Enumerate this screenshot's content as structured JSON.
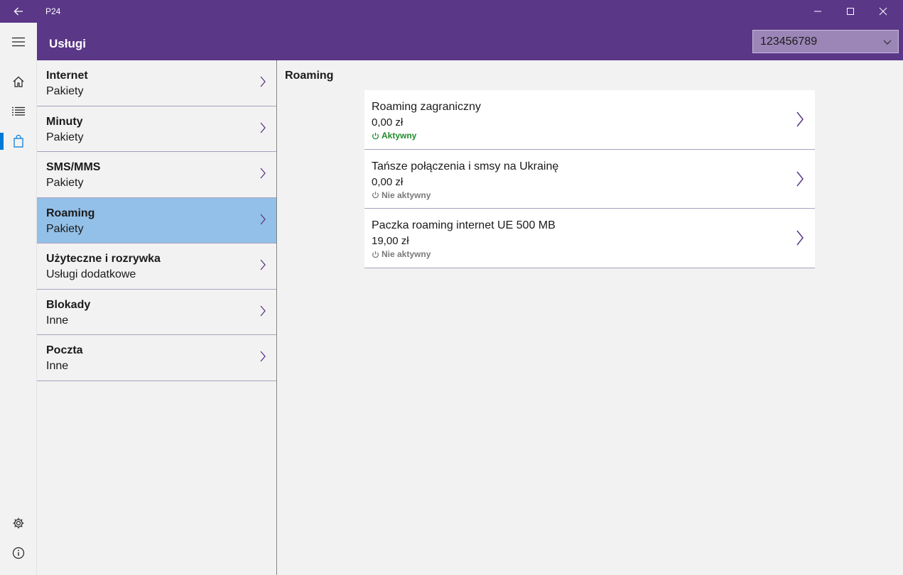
{
  "window": {
    "app_title": "P24",
    "icons": {
      "back": "back-arrow-icon",
      "minimize": "minimize-icon",
      "maximize": "maximize-icon",
      "close": "close-icon"
    }
  },
  "header": {
    "page_title": "Usługi",
    "account_selector": {
      "value": "123456789",
      "icon": "chevron-down-icon"
    }
  },
  "rail": {
    "items": [
      {
        "name": "hamburger-menu",
        "icon": "hamburger-icon"
      },
      {
        "name": "home",
        "icon": "home-icon"
      },
      {
        "name": "list",
        "icon": "list-icon"
      },
      {
        "name": "services",
        "icon": "shopping-bag-icon",
        "selected": true
      },
      {
        "name": "settings",
        "icon": "gear-icon"
      },
      {
        "name": "info",
        "icon": "info-icon"
      }
    ]
  },
  "categories": [
    {
      "title": "Internet",
      "subtitle": "Pakiety"
    },
    {
      "title": "Minuty",
      "subtitle": "Pakiety"
    },
    {
      "title": "SMS/MMS",
      "subtitle": "Pakiety"
    },
    {
      "title": "Roaming",
      "subtitle": "Pakiety",
      "selected": true
    },
    {
      "title": "Użyteczne i rozrywka",
      "subtitle": "Usługi dodatkowe"
    },
    {
      "title": "Blokady",
      "subtitle": "Inne"
    },
    {
      "title": "Poczta",
      "subtitle": "Inne"
    }
  ],
  "main": {
    "section_title": "Roaming",
    "services": [
      {
        "title": "Roaming zagraniczny",
        "price": "0,00 zł",
        "status": "Aktywny",
        "active": true
      },
      {
        "title": "Tańsze połączenia i smsy na Ukrainę",
        "price": "0,00 zł",
        "status": "Nie aktywny",
        "active": false
      },
      {
        "title": "Paczka roaming internet UE 500 MB",
        "price": "19,00 zł",
        "status": "Nie aktywny",
        "active": false
      }
    ]
  },
  "colors": {
    "brand_purple": "#5a3787",
    "selection_blue": "#93c0e8",
    "accent_blue": "#0078d7",
    "active_green": "#1e8c2b",
    "inactive_gray": "#7a7a7a",
    "chevron_purple": "#5a3787"
  }
}
